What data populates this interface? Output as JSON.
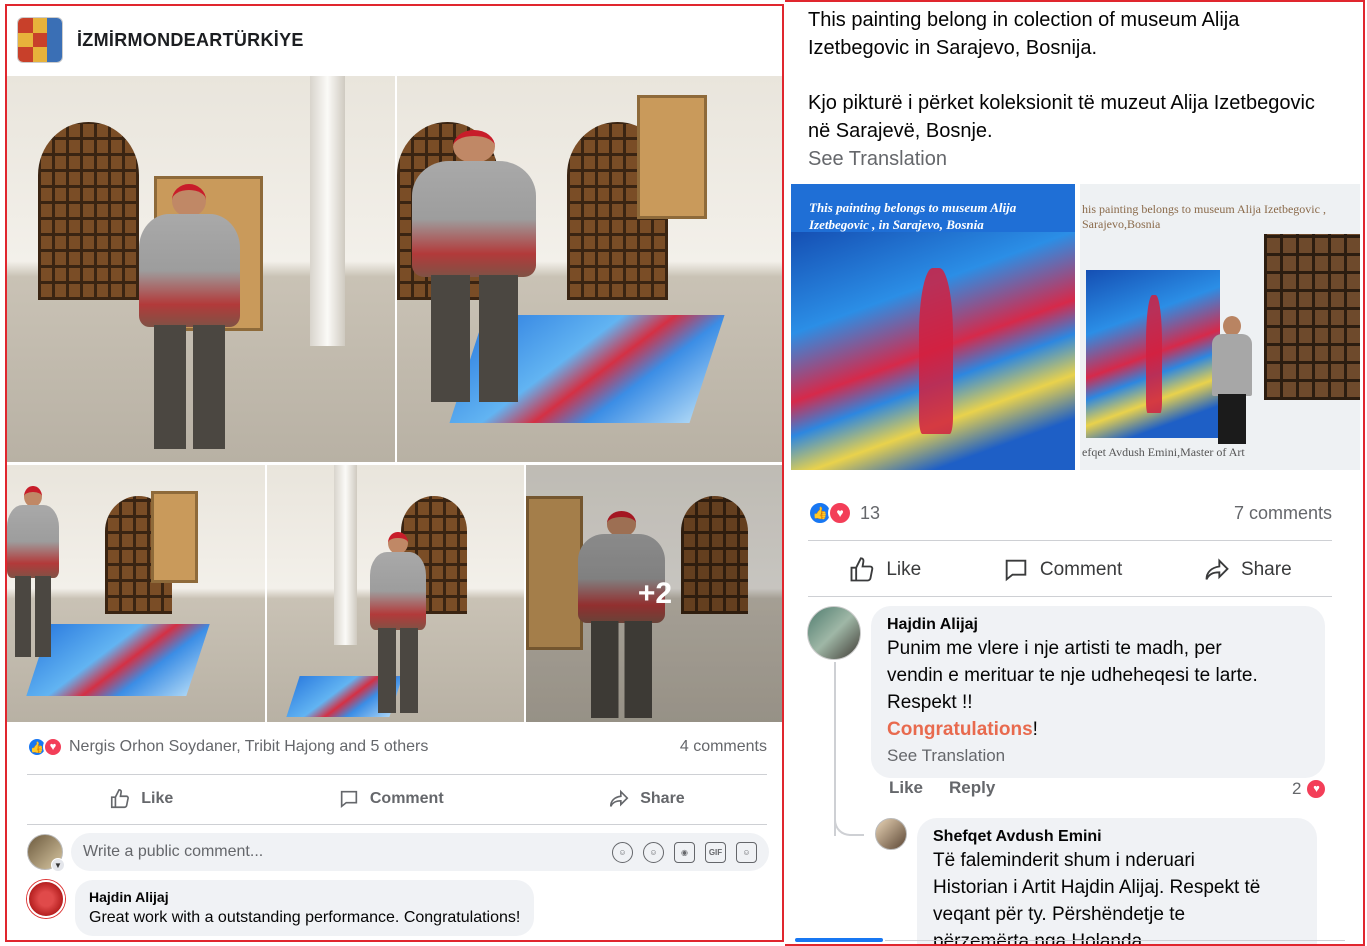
{
  "left_post": {
    "page_name": "İZMİRMONDEARTÜRKİYE",
    "more_photos": "+2",
    "reactions_text": "Nergis Orhon Soydaner, Tribit Hajong and 5 others",
    "comment_count": "4 comments",
    "actions": {
      "like": "Like",
      "comment": "Comment",
      "share": "Share"
    },
    "comment_placeholder": "Write a public comment...",
    "comment_input_icons": [
      "avatar-sticker-icon",
      "emoji-icon",
      "camera-icon",
      "gif-icon",
      "sticker-icon"
    ],
    "gif_label": "GIF",
    "comment": {
      "author": "Hajdin Alijaj",
      "text": "Great work with a outstanding performance. Congratulations!"
    }
  },
  "right_post": {
    "text_en": "This painting belong in colection of museum Alija Izetbegovic in Sarajevo, Bosnija.",
    "text_sq": "Kjo pikturë i përket koleksionit të muzeut Alija Izetbegovic në Sarajevë, Bosnje.",
    "see_translation": "See Translation",
    "image1_caption": "This painting belongs to museum Alija Izetbegovic , in Sarajevo, Bosnia",
    "image2_caption": "his painting belongs to museum Alija Izetbegovic , Sarajevo,Bosnia",
    "image2_footer": "efqet Avdush Emini,Master of Art",
    "reaction_count": "13",
    "comment_count": "7 comments",
    "actions": {
      "like": "Like",
      "comment": "Comment",
      "share": "Share"
    },
    "comment1": {
      "author": "Hajdin Alijaj",
      "line1": "Punim me vlere i nje artisti te madh, per",
      "line2": "vendin e merituar  te nje udheheqesi te larte.",
      "line3": "Respekt !!",
      "highlight": "Congratulations",
      "after_highlight": "!",
      "see_translation": "See Translation",
      "like": "Like",
      "reply": "Reply",
      "reaction_count": "2"
    },
    "comment2": {
      "author": "Shefqet Avdush Emini",
      "line1": "Të faleminderit shum i nderuari",
      "line2": "Historian i Artit Hajdin Alijaj. Respekt të",
      "line3": "veqant për ty. Përshëndetje te",
      "line4": "përzemërta nga Holanda"
    }
  },
  "colors": {
    "frame_red": "#e0262e",
    "like_blue": "#1877f2",
    "love_red": "#f33e58",
    "highlight_orange": "#e86a4e",
    "muted_text": "#65676b",
    "bubble_bg": "#f0f2f5"
  }
}
